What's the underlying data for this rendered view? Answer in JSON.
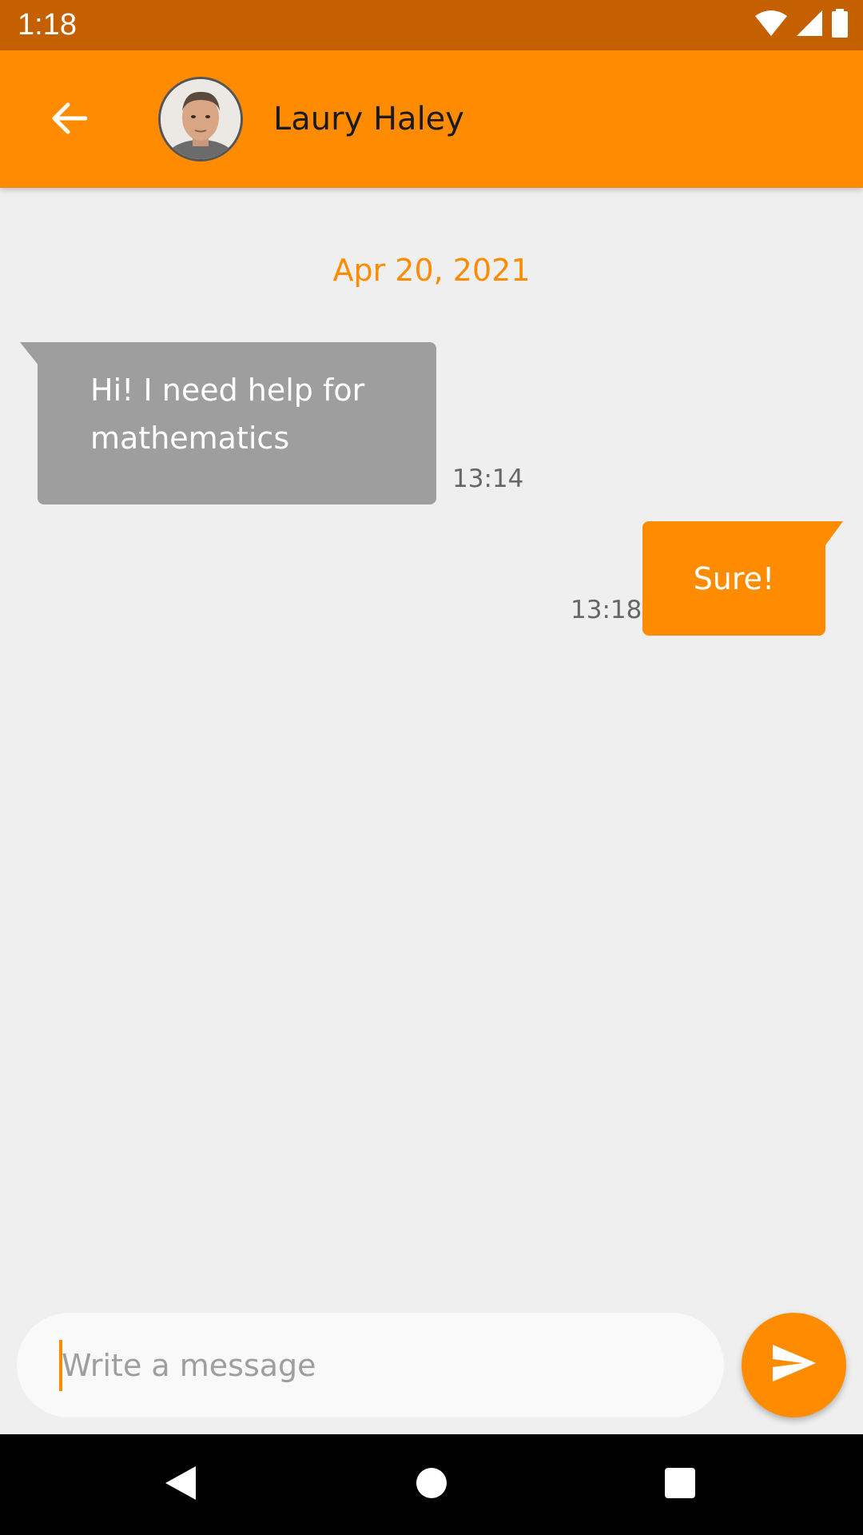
{
  "status_bar": {
    "time": "1:18",
    "icons": [
      "wifi-icon",
      "signal-icon",
      "battery-icon"
    ]
  },
  "header": {
    "back_icon": "arrow-left-icon",
    "contact_name": "Laury Haley",
    "avatar": "avatar"
  },
  "chat": {
    "date": "Apr 20, 2021",
    "messages": [
      {
        "direction": "incoming",
        "text": "Hi! I need help for mathematics",
        "time": "13:14"
      },
      {
        "direction": "outgoing",
        "text": "Sure!",
        "time": "13:18"
      }
    ]
  },
  "composer": {
    "value": "",
    "placeholder": "Write a message",
    "send_icon": "send-icon"
  },
  "nav_bar": {
    "icons": [
      "nav-back-icon",
      "nav-home-icon",
      "nav-recents-icon"
    ]
  },
  "colors": {
    "accent": "#ff8c00",
    "status_bar": "#c56000",
    "incoming_bubble": "#9e9e9e",
    "background": "#efefef"
  }
}
